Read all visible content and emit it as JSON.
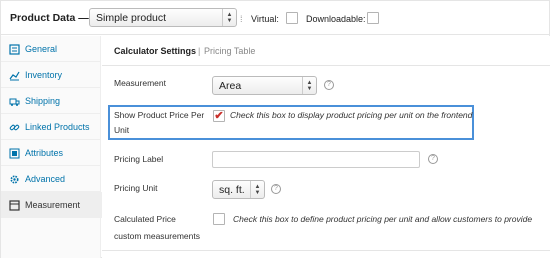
{
  "header": {
    "title": "Product Data —",
    "product_type": "Simple product",
    "virtual_label": "Virtual:",
    "downloadable_label": "Downloadable:"
  },
  "sidebar": {
    "items": [
      {
        "label": "General",
        "icon": "general-icon"
      },
      {
        "label": "Inventory",
        "icon": "inventory-icon"
      },
      {
        "label": "Shipping",
        "icon": "shipping-icon"
      },
      {
        "label": "Linked Products",
        "icon": "link-icon"
      },
      {
        "label": "Attributes",
        "icon": "attributes-icon"
      },
      {
        "label": "Advanced",
        "icon": "gear-icon"
      },
      {
        "label": "Measurement",
        "icon": "measurement-icon",
        "active": true
      }
    ]
  },
  "subtabs": {
    "active": "Calculator Settings",
    "separator": "|",
    "other": "Pricing Table"
  },
  "form": {
    "measurement": {
      "label": "Measurement",
      "value": "Area"
    },
    "show_price": {
      "label_line1": "Show Product Price Per",
      "label_line2": "Unit",
      "checked": true,
      "description": "Check this box to display product pricing per unit on the frontend"
    },
    "pricing_label": {
      "label": "Pricing Label",
      "value": ""
    },
    "pricing_unit": {
      "label": "Pricing Unit",
      "value": "sq. ft."
    },
    "calculated_price": {
      "label_line1": "Calculated Price",
      "label_line2": "custom measurements",
      "checked": false,
      "description": "Check this box to define product pricing per unit and allow customers to provide"
    },
    "help_glyph": "?"
  },
  "colors": {
    "link": "#0073aa",
    "highlight_border": "#4a90d9",
    "checkmark": "#c9302c"
  }
}
